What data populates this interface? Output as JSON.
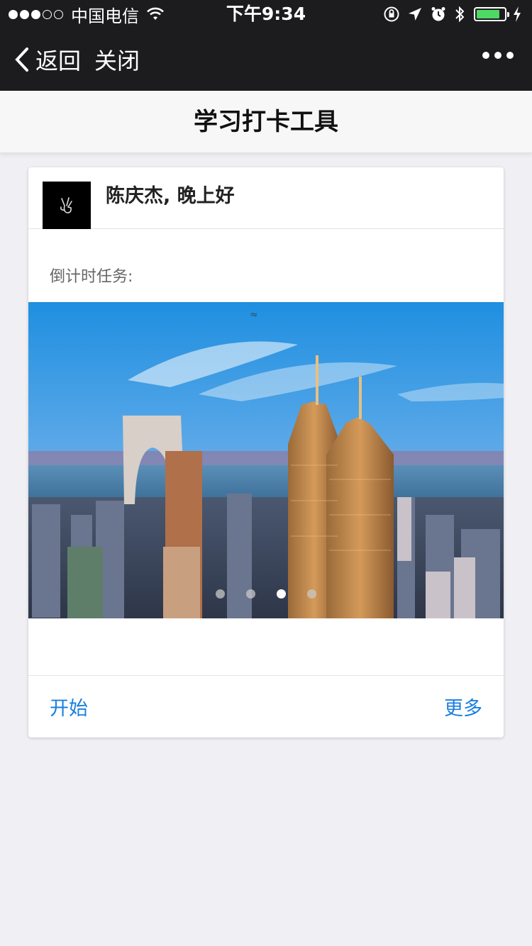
{
  "status_bar": {
    "carrier": "中国电信",
    "time": "下午9:34",
    "signal_bars_full": 3,
    "signal_bars_total": 5,
    "battery_level": 0.85,
    "battery_color": "#4cd964",
    "icons": [
      "wifi-icon",
      "rotation-lock-icon",
      "location-icon",
      "alarm-icon",
      "bluetooth-icon",
      "battery-icon",
      "charging-icon"
    ]
  },
  "nav": {
    "back_label": "返回",
    "close_label": "关闭",
    "more_icon": "more-dots-icon"
  },
  "page": {
    "title": "学习打卡工具"
  },
  "card": {
    "greeting": "陈庆杰, 晚上好",
    "task_label": "倒计时任务:",
    "carousel": {
      "slide_count": 4,
      "active_index": 2,
      "image_description": "city-skyline-photo"
    },
    "footer": {
      "start_label": "开始",
      "more_label": "更多"
    }
  },
  "colors": {
    "nav_bg": "#1c1c1e",
    "page_bg": "#efeff4",
    "accent": "#1a7fe0"
  }
}
